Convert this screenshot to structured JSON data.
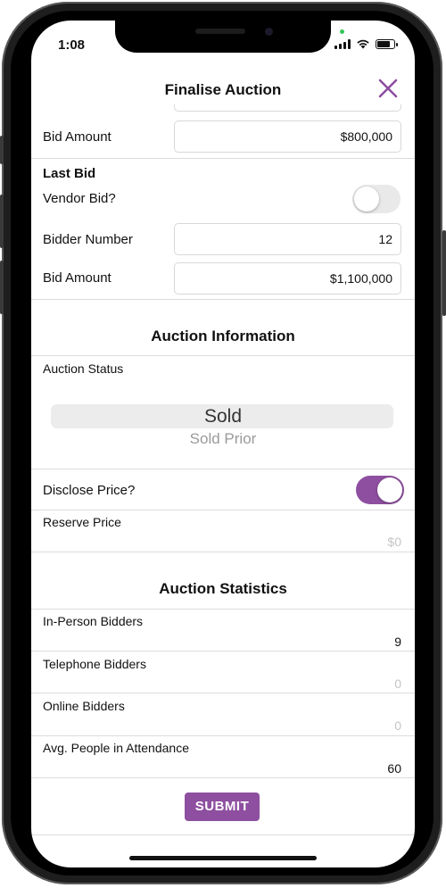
{
  "status_bar": {
    "time": "1:08"
  },
  "header": {
    "title": "Finalise Auction",
    "close_icon": "close-icon"
  },
  "first_bid": {
    "bid_amount_label": "Bid Amount",
    "bid_amount_value": "$800,000"
  },
  "last_bid": {
    "title": "Last Bid",
    "vendor_bid_label": "Vendor Bid?",
    "vendor_bid_on": false,
    "bidder_number_label": "Bidder Number",
    "bidder_number_value": "12",
    "bid_amount_label": "Bid Amount",
    "bid_amount_value": "$1,100,000"
  },
  "auction_information": {
    "title": "Auction Information",
    "status_label": "Auction Status",
    "status_selected": "Sold",
    "status_next": "Sold Prior",
    "disclose_price_label": "Disclose Price?",
    "disclose_price_on": true,
    "reserve_price_label": "Reserve Price",
    "reserve_price_placeholder": "$0"
  },
  "auction_statistics": {
    "title": "Auction Statistics",
    "rows": [
      {
        "label": "In-Person Bidders",
        "value": "9",
        "muted": false
      },
      {
        "label": "Telephone Bidders",
        "value": "0",
        "muted": true
      },
      {
        "label": "Online Bidders",
        "value": "0",
        "muted": true
      },
      {
        "label": "Avg. People in Attendance",
        "value": "60",
        "muted": false
      }
    ]
  },
  "submit": {
    "label": "SUBMIT"
  },
  "colors": {
    "accent": "#8e4fa0",
    "toggle_off": "#e9e9ea"
  }
}
